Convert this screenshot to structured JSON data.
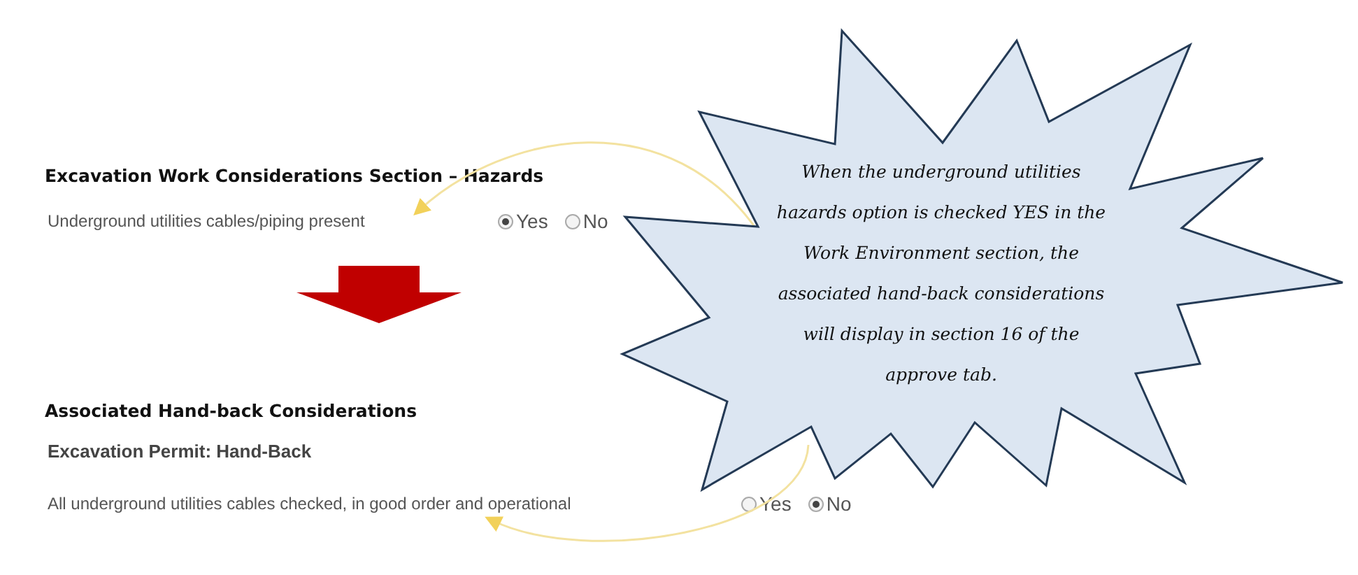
{
  "hazards_section": {
    "heading": "Excavation Work Considerations Section – Hazards",
    "question": {
      "label": "Underground utilities cables/piping present",
      "options": [
        {
          "label": "Yes",
          "selected": true
        },
        {
          "label": "No",
          "selected": false
        }
      ]
    }
  },
  "handback_section": {
    "heading": "Associated Hand-back Considerations",
    "subheading": "Excavation Permit: Hand-Back",
    "question": {
      "label": "All underground utilities cables checked, in good order and operational",
      "options": [
        {
          "label": "Yes",
          "selected": false
        },
        {
          "label": "No",
          "selected": true
        }
      ]
    }
  },
  "callout": {
    "text": "When the underground utilities hazards option is checked YES in the Work Environment section, the associated hand-back considerations will display in section 16 of the approve tab."
  }
}
